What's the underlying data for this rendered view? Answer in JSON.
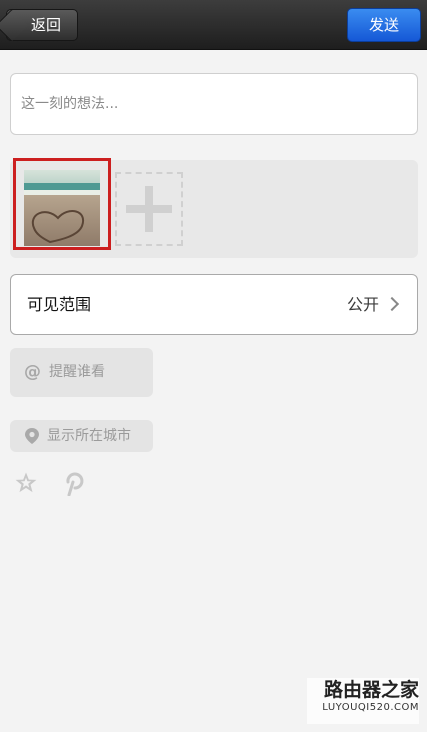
{
  "navbar": {
    "back_label": "返回",
    "send_label": "发送"
  },
  "compose": {
    "placeholder": "这一刻的想法..."
  },
  "photos": {
    "thumbnail_icon": "beach-heart-photo",
    "add_icon": "plus-icon"
  },
  "visibility": {
    "label": "可见范围",
    "value": "公开"
  },
  "options": {
    "mention_label": "提醒谁看",
    "location_label": "显示所在城市"
  },
  "watermark": {
    "title": "路由器之家",
    "url": "LUYOUQI520.COM"
  },
  "colors": {
    "send_accent": "#1f6ee6",
    "thumbnail_highlight": "#cc1f1f",
    "navbar": "#2a2a2a"
  }
}
